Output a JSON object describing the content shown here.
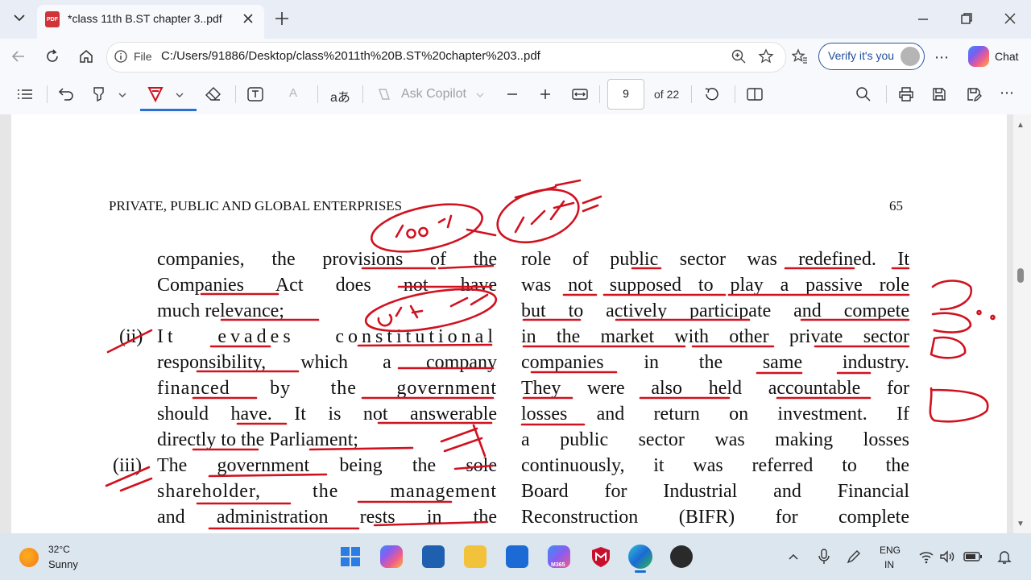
{
  "browser": {
    "tab_title": "*class 11th B.ST chapter 3..pdf",
    "tab_file_badge": "PDF",
    "new_tab_icon": "plus-icon",
    "address": {
      "scheme_label": "File",
      "url": "C:/Users/91886/Desktop/class%2011th%20B.ST%20chapter%203..pdf"
    },
    "verify_label": "Verify it's you",
    "chat_label": "Chat"
  },
  "pdf_toolbar": {
    "ask_copilot": "Ask Copilot",
    "current_page": "9",
    "total_pages_label": "of 22",
    "read_aloud_glyph": "aあ"
  },
  "document": {
    "header_left": "PRIVATE, PUBLIC AND GLOBAL ENTERPRISES",
    "header_right": "65",
    "left_column": [
      {
        "marker": "",
        "text": "companies, the provisions of the"
      },
      {
        "marker": "",
        "text": "Companies Act does not have"
      },
      {
        "marker": "",
        "text": "much relevance;"
      },
      {
        "marker": "(ii)",
        "text": "It evades constitutional"
      },
      {
        "marker": "",
        "text": "responsibility, which a company"
      },
      {
        "marker": "",
        "text": "financed by the government"
      },
      {
        "marker": "",
        "text": "should have. It is not answerable"
      },
      {
        "marker": "",
        "text": "directly to the Parliament;"
      },
      {
        "marker": "(iii)",
        "text": "The government being the sole"
      },
      {
        "marker": "",
        "text": "shareholder, the management"
      },
      {
        "marker": "",
        "text": "and administration rests in the"
      }
    ],
    "right_column": [
      "role of public sector was redefined. It",
      "was not supposed to play a passive role",
      "but to actively participate and compete",
      "in the market with other private sector",
      "companies in the same industry.",
      "They were also held accountable for",
      "losses and return on investment. If",
      "a public sector was making losses",
      "continuously, it was referred to the",
      "Board for Industrial and Financial",
      "Reconstruction (BIFR) for complete"
    ],
    "ink_color": "#d0121f"
  },
  "taskbar": {
    "weather_temp": "32°C",
    "weather_desc": "Sunny",
    "lang_line1": "ENG",
    "lang_line2": "IN",
    "outlook_badge": "M365"
  }
}
